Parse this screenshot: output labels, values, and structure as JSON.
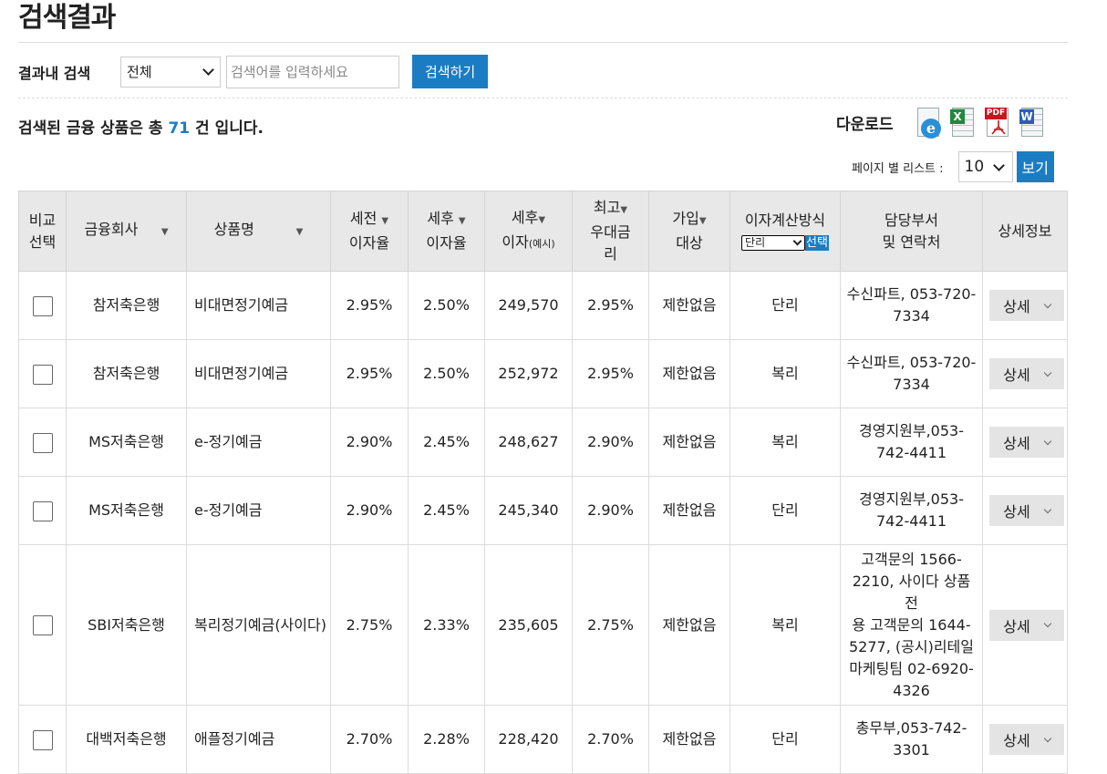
{
  "page": {
    "title": "검색결과"
  },
  "search": {
    "label": "결과내 검색",
    "scope_value": "전체",
    "placeholder": "검색어를 입력하세요",
    "button_label": "검색하기"
  },
  "summary": {
    "prefix": "검색된 금융 상품은 총 ",
    "count": "71",
    "suffix": " 건 입니다."
  },
  "download": {
    "label": "다운로드",
    "icons": [
      "ie-icon",
      "excel-icon",
      "pdf-icon",
      "word-icon"
    ]
  },
  "pagination": {
    "label": "페이지 별 리스트 :",
    "value": "10",
    "button_label": "보기"
  },
  "table": {
    "headers": {
      "compare_1": "비교",
      "compare_2": "선택",
      "company": "금융회사",
      "product": "상품명",
      "pretax_1": "세전",
      "pretax_2": "이자율",
      "posttax_1": "세후",
      "posttax_2": "이자율",
      "interest_1": "세후",
      "interest_2": "이자",
      "interest_unit": "(예시)",
      "max_1": "최고",
      "max_2": "우대금",
      "max_3": "리",
      "join_1": "가입",
      "join_2": "대상",
      "calc": "이자계산방식",
      "calc_select": "단리",
      "calc_btn": "선택",
      "dept_1": "담당부서",
      "dept_2": "및 연락처",
      "detail": "상세정보"
    },
    "detail_label": "상세",
    "rows": [
      {
        "company": "참저축은행",
        "product": "비대면정기예금",
        "pretax": "2.95%",
        "posttax": "2.50%",
        "interest": "249,570",
        "max": "2.95%",
        "target": "제한없음",
        "method": "단리",
        "contact_lines": [
          "수신파트, 053-720-",
          "7334"
        ]
      },
      {
        "company": "참저축은행",
        "product": "비대면정기예금",
        "pretax": "2.95%",
        "posttax": "2.50%",
        "interest": "252,972",
        "max": "2.95%",
        "target": "제한없음",
        "method": "복리",
        "contact_lines": [
          "수신파트, 053-720-",
          "7334"
        ]
      },
      {
        "company": "MS저축은행",
        "product": "e-정기예금",
        "pretax": "2.90%",
        "posttax": "2.45%",
        "interest": "248,627",
        "max": "2.90%",
        "target": "제한없음",
        "method": "복리",
        "contact_lines": [
          "경영지원부,053-",
          "742-4411"
        ]
      },
      {
        "company": "MS저축은행",
        "product": "e-정기예금",
        "pretax": "2.90%",
        "posttax": "2.45%",
        "interest": "245,340",
        "max": "2.90%",
        "target": "제한없음",
        "method": "단리",
        "contact_lines": [
          "경영지원부,053-",
          "742-4411"
        ]
      },
      {
        "company": "SBI저축은행",
        "product": "복리정기예금(사이다)",
        "pretax": "2.75%",
        "posttax": "2.33%",
        "interest": "235,605",
        "max": "2.75%",
        "target": "제한없음",
        "method": "복리",
        "contact_lines": [
          "고객문의 1566-",
          "2210, 사이다 상품 전",
          "용 고객문의 1644-",
          "5277, (공시)리테일",
          "마케팅팀 02-6920-",
          "4326"
        ]
      },
      {
        "company": "대백저축은행",
        "product": "애플정기예금",
        "pretax": "2.70%",
        "posttax": "2.28%",
        "interest": "228,420",
        "max": "2.70%",
        "target": "제한없음",
        "method": "단리",
        "contact_lines": [
          "총무부,053-742-",
          "3301"
        ]
      }
    ]
  }
}
